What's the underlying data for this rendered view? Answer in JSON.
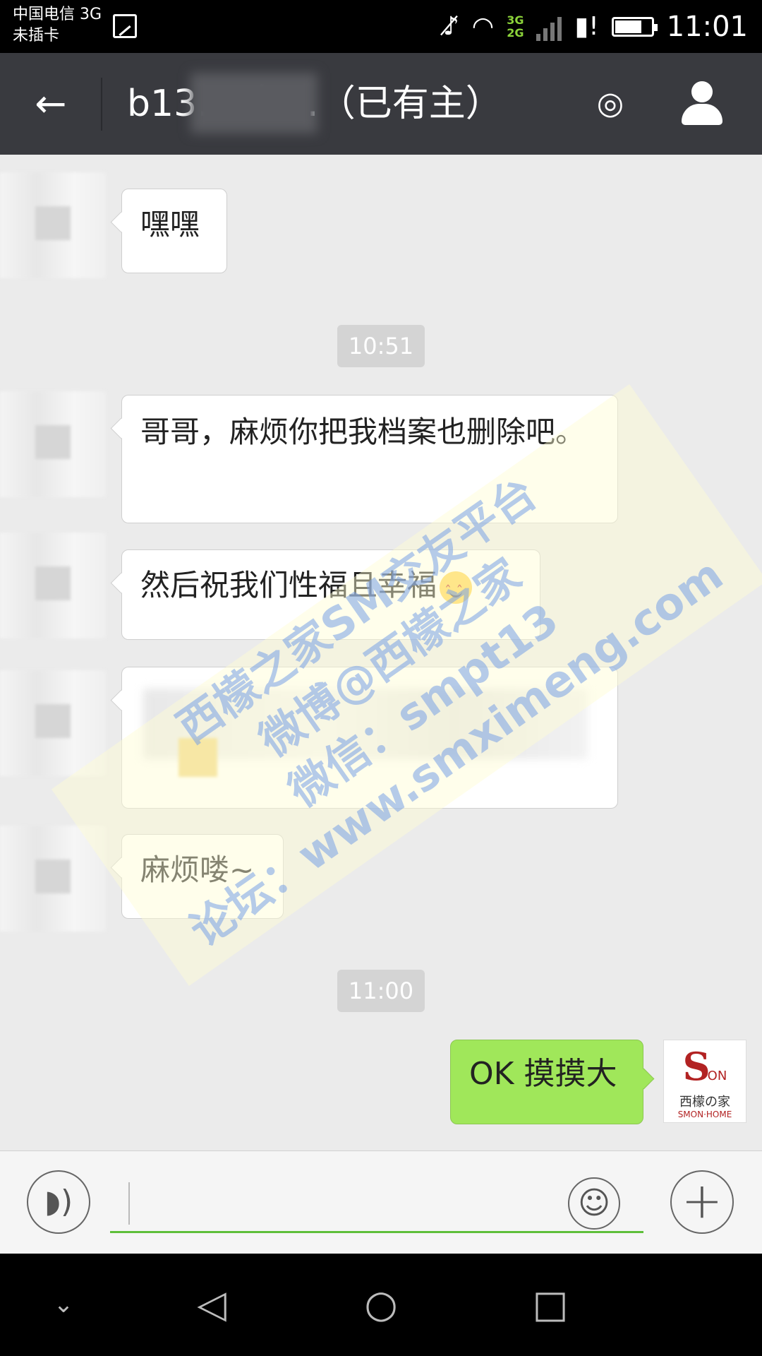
{
  "status_bar": {
    "carrier_line1": "中国电信 3G",
    "carrier_line2": "未插卡",
    "network_top": "3G",
    "network_bottom": "2G",
    "time": "11:01",
    "battery_level_percent": 75
  },
  "header": {
    "back_glyph": "←",
    "title": "b13…    女…（已有主）",
    "ear_glyph": "◎"
  },
  "messages": [
    {
      "side": "left",
      "text": "嘿嘿"
    },
    {
      "type": "time",
      "text": "10:51"
    },
    {
      "side": "left",
      "text": "哥哥，麻烦你把我档案也删除吧。"
    },
    {
      "side": "left",
      "text": "然后祝我们性福且幸福",
      "emoji": "smiling-face-emoji"
    },
    {
      "side": "left",
      "text": "",
      "blurred": true
    },
    {
      "side": "left",
      "text": "麻烦喽~"
    },
    {
      "type": "time",
      "text": "11:00"
    },
    {
      "side": "right",
      "text": "OK 摸摸大"
    }
  ],
  "my_avatar": {
    "logo_mark": "S",
    "logo_on": "ON",
    "logo_cn": "西檬の家",
    "logo_en": "SMON·HOME"
  },
  "watermark": {
    "line1": "西檬之家SM交友平台",
    "line2": "微博@西檬之家",
    "line3": "微信：smpt13",
    "line4": "论坛：www.smximeng.com"
  },
  "input_bar": {
    "voice_glyph": "◗)",
    "smile_glyph": "☺",
    "plus_glyph": "+",
    "input_value": ""
  },
  "nav_bar": {
    "hide_glyph": "⌄",
    "back_glyph": "◁",
    "home_glyph": "○",
    "recent_glyph": "□"
  },
  "colors": {
    "header_bg": "#393a3f",
    "chat_bg": "#ebebeb",
    "sent_bubble": "#a0e75a",
    "input_underline": "#5fbf3a"
  }
}
